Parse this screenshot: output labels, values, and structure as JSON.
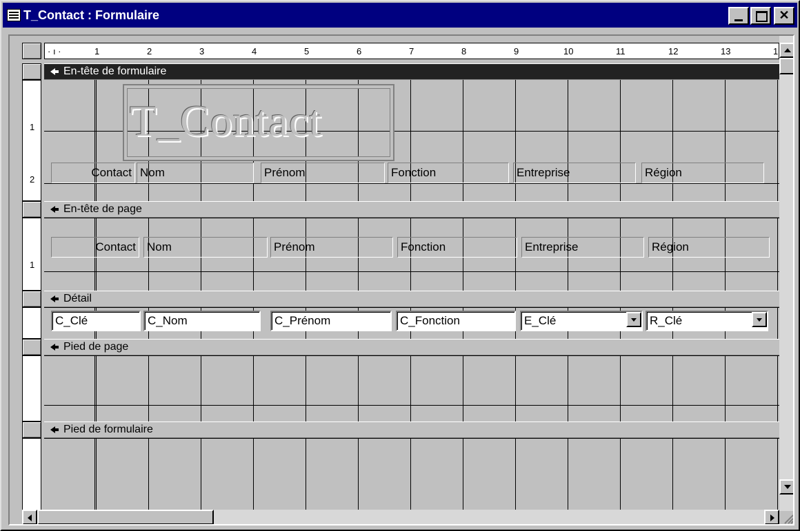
{
  "window": {
    "title": "T_Contact : Formulaire",
    "close_glyph": "✕"
  },
  "ruler": {
    "horizontal_marks": [
      "1",
      "2",
      "3",
      "4",
      "5",
      "6",
      "7",
      "8",
      "9",
      "10",
      "11",
      "12",
      "13",
      "1"
    ],
    "vertical_marks_header": [
      "1",
      "2"
    ],
    "vertical_marks_page": [
      "1"
    ]
  },
  "sections": {
    "form_header": "En-tête de formulaire",
    "page_header": "En-tête de page",
    "detail": "Détail",
    "page_footer": "Pied de page",
    "form_footer": "Pied de formulaire"
  },
  "form_header": {
    "logo_text": "T_Contact",
    "labels": [
      "Contact",
      "Nom",
      "Prénom",
      "Fonction",
      "Entreprise",
      "Région"
    ]
  },
  "page_header": {
    "labels": [
      "Contact",
      "Nom",
      "Prénom",
      "Fonction",
      "Entreprise",
      "Région"
    ]
  },
  "detail": {
    "fields": [
      "C_Clé",
      "C_Nom",
      "C_Prénom",
      "C_Fonction",
      "E_Clé",
      "R_Clé"
    ]
  },
  "icons": {
    "app": "form-icon",
    "section_arrow": "section-arrow-icon"
  },
  "colors": {
    "titlebar": "#000080",
    "selected_section": "#222222",
    "face": "#c0c0c0"
  }
}
